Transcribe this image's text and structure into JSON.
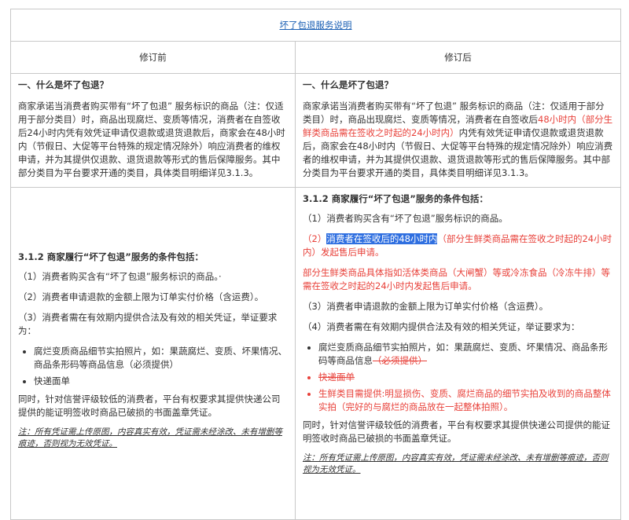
{
  "title": "坏了包退服务说明",
  "headers": {
    "before": "修订前",
    "after": "修订后"
  },
  "section1": {
    "heading": "一、什么是坏了包退？",
    "before_text": "商家承诺当消费者购买带有“坏了包退” 服务标识的商品（注：仅适用于部分类目）时，商品出现腐烂、变质等情况，消费者在自签收后24小时内凭有效凭证申请仅退款或退货退款后，商家会在48小时内（节假日、大促等平台特殊的规定情况除外）响应消费者的维权申请，并为其提供仅退款、退货退款等形式的售后保障服务。其中部分类目为平台要求开通的类目，具体类目明细详见3.1.3。",
    "after_part1": "商家承诺当消费者购买带有“坏了包退” 服务标识的商品（注：仅适用于部分类目）时，商品出现腐烂、变质等情况，消费者在自签收后",
    "after_red": "48小时内（部分生鲜类商品需在签收之时起的24小时内）",
    "after_part2": "内凭有效凭证申请仅退款或退货退款后，商家会在48小时内（节假日、大促等平台特殊的规定情况除外）响应消费者的维权申请，并为其提供仅退款、退货退款等形式的售后保障服务。其中部分类目为平台要求开通的类目，具体类目明细详见3.1.3。"
  },
  "section2": {
    "heading": "3.1.2 商家履行“坏了包退”服务的条件包括：",
    "before": {
      "c1": "（1）消费者购买含有“坏了包退”服务标识的商品。·",
      "c2": "（2）消费者申请退款的金额上限为订单实付价格（含运费）。",
      "c3": "（3）消费者需在有效期内提供合法及有效的相关凭证，举证要求为：",
      "b1": "腐烂变质商品细节实拍照片，如：果蔬腐烂、变质、坏果情况、商品条形码等商品信息（必须提供）",
      "b2": "快递面单",
      "closing": "同时，针对信誉评级较低的消费者，平台有权要求其提供快递公司提供的能证明签收时商品已破损的书面盖章凭证。",
      "note": "注：所有凭证需上传原图，内容真实有效，凭证需未经涂改、未有增删等痕迹，否则视为无效凭证。"
    },
    "after": {
      "c1": "（1）消费者购买含有“坏了包退”服务标识的商品。",
      "c2_prefix": "（2）",
      "c2_highlight": "消费者在签收后的48小时内",
      "c2_rest": "（部分生鲜类商品需在签收之时起的24小时内）发起售后申请。",
      "fresh_note": "部分生鲜类商品具体指如活体类商品（大闸蟹）等或冷冻食品（冷冻牛排）等需在签收之时起的24小时内发起售后申请。",
      "c3": "（3）消费者申请退款的金额上限为订单实付价格（含运费）。",
      "c4": "（4）消费者需在有效期内提供合法及有效的相关凭证，举证要求为：",
      "b1_main": "腐烂变质商品细节实拍照片，如：果蔬腐烂、变质、坏果情况、商品条形码等商品信息",
      "b1_struck": "（必须提供）",
      "b2_struck": "快递面单",
      "b3": "生鲜类目需提供:明显损伤、变质、腐烂商品的细节实拍及收到的商品整体实拍（完好的与腐烂的商品放在一起整体拍照）。",
      "closing": "同时，针对信誉评级较低的消费者，平台有权要求其提供快递公司提供的能证明签收时商品已破损的书面盖章凭证。",
      "note": "注：所有凭证需上传原图，内容真实有效，凭证需未经涂改、未有增删等痕迹，否则视为无效凭证。"
    }
  }
}
